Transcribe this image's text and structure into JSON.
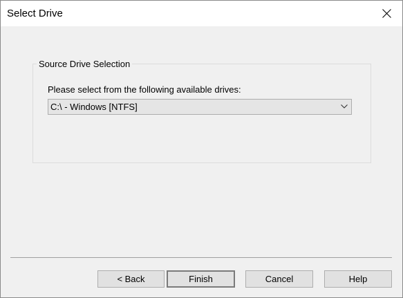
{
  "window": {
    "title": "Select Drive"
  },
  "group": {
    "legend": "Source Drive Selection",
    "prompt": "Please select from the following available drives:",
    "drive_select": {
      "selected": "C:\\ - Windows  [NTFS]"
    }
  },
  "buttons": {
    "back": "< Back",
    "finish": "Finish",
    "cancel": "Cancel",
    "help": "Help"
  }
}
